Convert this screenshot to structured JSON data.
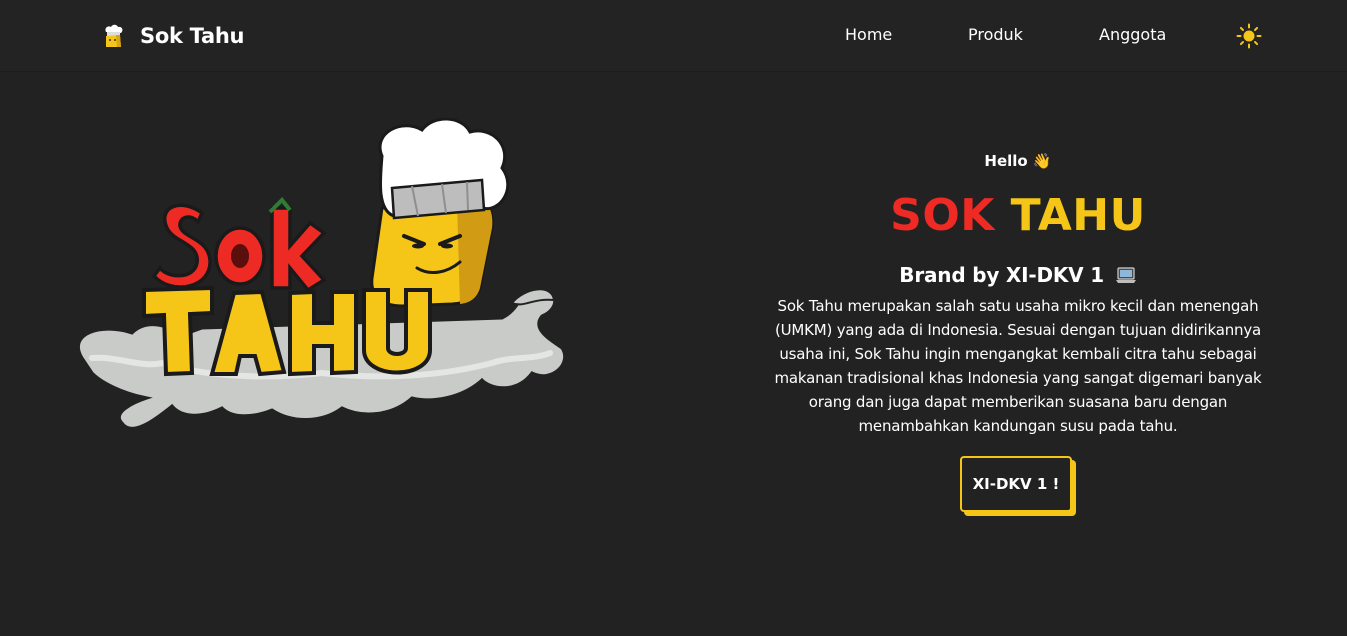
{
  "header": {
    "brand": "Sok Tahu",
    "nav": {
      "home": "Home",
      "produk": "Produk",
      "anggota": "Anggota"
    },
    "theme_icon": "sun-icon"
  },
  "hero": {
    "logo_image": "sok-tahu-logo",
    "greeting": "Hello 👋",
    "title_part1": "SOK",
    "title_part2": "TAHU",
    "subtitle": "Brand by XI-DKV 1",
    "subtitle_icon": "laptop-icon",
    "description": "Sok Tahu merupakan salah satu usaha mikro kecil dan menengah (UMKM) yang ada di Indonesia. Sesuai dengan tujuan didirikannya usaha ini, Sok Tahu ingin mengangkat kembali citra tahu sebagai makanan tradisional khas Indonesia yang sangat digemari banyak orang dan juga dapat memberikan suasana baru dengan menambahkan kandungan susu pada tahu.",
    "cta_label": "XI-DKV 1 !"
  },
  "colors": {
    "background": "#222222",
    "accent_red": "#ee2a24",
    "accent_yellow": "#f5c518"
  }
}
